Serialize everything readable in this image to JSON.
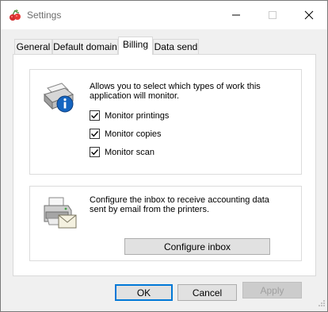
{
  "window": {
    "title": "Settings",
    "app_icon": "cherry-app-icon",
    "controls": [
      "minimize-icon",
      "maximize-icon",
      "close-icon"
    ]
  },
  "tabs": [
    {
      "label": "General",
      "active": false
    },
    {
      "label": "Default domain",
      "active": false
    },
    {
      "label": "Billing",
      "active": true
    },
    {
      "label": "Data send",
      "active": false
    }
  ],
  "monitor_group": {
    "icon": "printer-info-icon",
    "description": "Allows you to select which types of work this application will monitor.",
    "checkboxes": [
      {
        "label": "Monitor printings",
        "checked": true
      },
      {
        "label": "Monitor copies",
        "checked": true
      },
      {
        "label": "Monitor scan",
        "checked": true
      }
    ]
  },
  "inbox_group": {
    "icon": "printer-mail-icon",
    "description": "Configure the inbox to receive accounting data sent by email from the printers.",
    "button_label": "Configure inbox"
  },
  "footer": {
    "ok_label": "OK",
    "cancel_label": "Cancel",
    "apply_label": "Apply",
    "apply_enabled": false
  },
  "colors": {
    "accent": "#0078d7",
    "dialog_bg": "#f0f0f0",
    "panel_bg": "#ffffff"
  }
}
